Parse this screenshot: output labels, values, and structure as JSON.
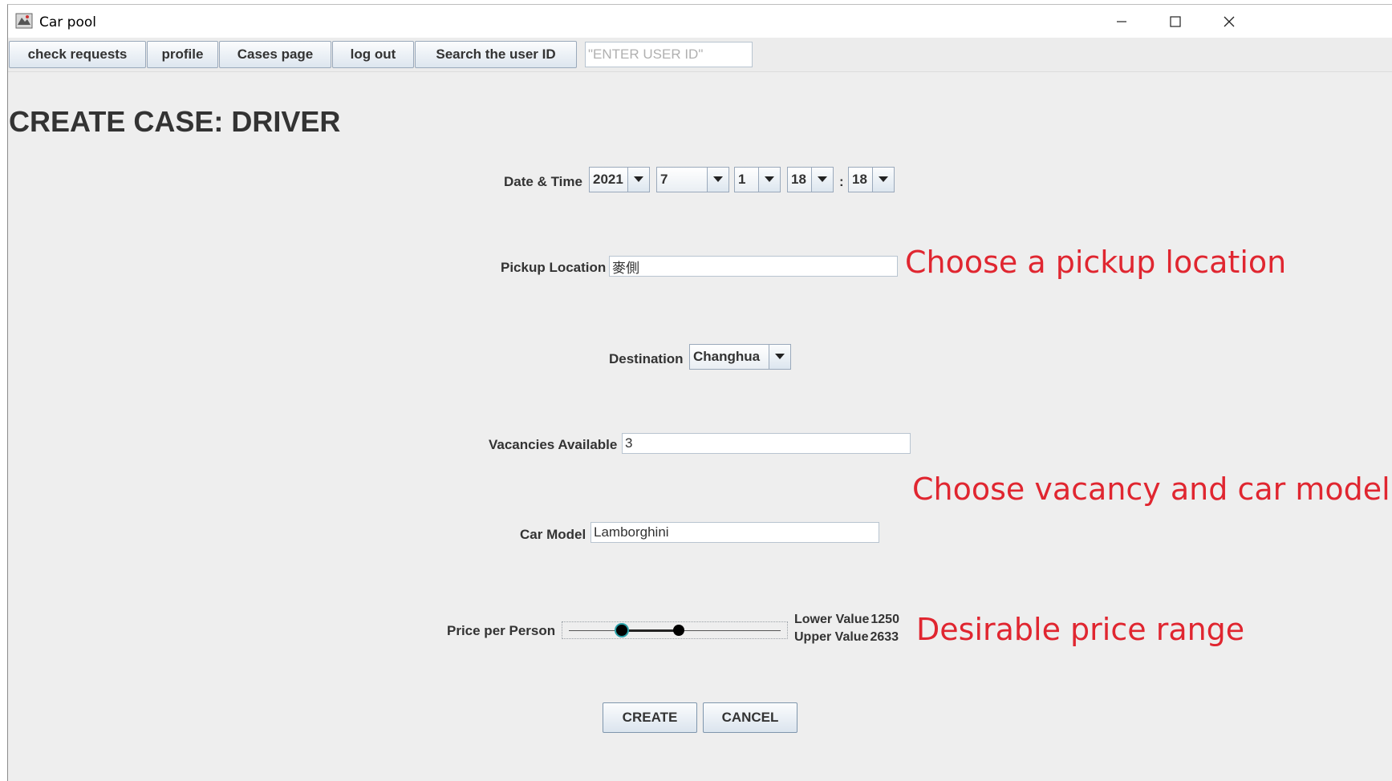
{
  "window": {
    "title": "Car pool",
    "icon": "car-app-icon",
    "controls": [
      "minimize-icon",
      "maximize-icon",
      "close-icon"
    ]
  },
  "toolbar": {
    "check_requests": "check requests",
    "profile": "profile",
    "cases_page": "Cases page",
    "log_out": "log out",
    "search_user_id": "Search the user ID",
    "search_placeholder": "\"ENTER USER ID\""
  },
  "form": {
    "page_title": "CREATE CASE: DRIVER",
    "datetime_label": "Date & Time",
    "year": "2021",
    "month": "7",
    "day": "1",
    "hour": "18",
    "time_separator": ":",
    "minute": "18",
    "pickup_label": "Pickup Location",
    "pickup_value": "麥側",
    "destination_label": "Destination",
    "destination_value": "Changhua",
    "vacancies_label": "Vacancies Available",
    "vacancies_value": "3",
    "car_model_label": "Car Model",
    "car_model_value": "Lamborghini",
    "price_label": "Price per Person",
    "lower_label": "Lower Value",
    "lower_value": "1250",
    "upper_label": "Upper Value",
    "upper_value": "2633",
    "price_range": {
      "lower_fraction": 0.25,
      "upper_fraction": 0.52
    },
    "create_label": "CREATE",
    "cancel_label": "CANCEL"
  },
  "annotations": {
    "pickup": "Choose a pickup location",
    "vacancy_car": "Choose vacancy and car model",
    "price": "Desirable price range",
    "color": "#e02630"
  }
}
